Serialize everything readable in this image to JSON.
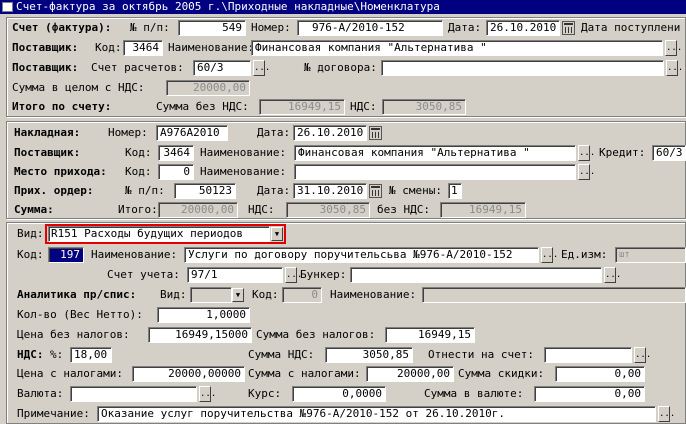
{
  "window": {
    "title": "Счет-фактура за октябрь 2005 г.\\Приходные накладные\\Номенклатура"
  },
  "invoice": {
    "title": "Счет (фактура):",
    "num_label": "№ п/п:",
    "num_value": "549",
    "number_label": "Номер:",
    "number_value": "976-А/2010-152",
    "date_label": "Дата:",
    "date_value": "26.10.2010",
    "date_received_label": "Дата поступлени",
    "supplier_label": "Поставщик:",
    "code_label": "Код:",
    "code_value": "3464",
    "name_label": "Наименование:",
    "name_value": "Финансовая компания \"Альтернатива \"",
    "supplier2_label": "Поставщик:",
    "account_label": "Счет расчетов:",
    "account_value": "60/3",
    "contract_label": "№ договора:",
    "contract_value": "",
    "sum_vat_label": "Сумма в целом с НДС:",
    "sum_vat_value": "20000,00",
    "total_label": "Итого   по   счету:",
    "sum_novat_label": "Сумма без НДС:",
    "sum_novat_value": "16949,15",
    "vat_label": "НДС:",
    "vat_value": "3050,85"
  },
  "waybill": {
    "title": "Накладная:",
    "number_label": "Номер:",
    "number_value": "А976А2010",
    "date_label": "Дата:",
    "date_value": "26.10.2010",
    "supplier_label": "Поставщик:",
    "code_label": "Код:",
    "code_value": "3464",
    "name_label": "Наименование:",
    "name_value": "Финансовая компания \"Альтернатива \"",
    "credit_label": "Кредит:",
    "credit_value": "60/3",
    "place_label": "Место прихода:",
    "place_code_label": "Код:",
    "place_code_value": "0",
    "place_name_label": "Наименование:",
    "place_name_value": "",
    "order_label": "Прих. ордер:",
    "order_num_label": "№ п/п:",
    "order_num_value": "50123",
    "order_date_label": "Дата:",
    "order_date_value": "31.10.2010",
    "shift_label": "№ смены:",
    "shift_value": "1",
    "sum_label": "Сумма:",
    "total_label": "Итого:",
    "total_value": "20000,00",
    "vat_label": "НДС:",
    "vat_value": "3050,85",
    "novat_label": "без НДС:",
    "novat_value": "16949,15"
  },
  "nomenclature": {
    "kind_label": "Вид:",
    "kind_value": "R151 Расходы будущих периодов",
    "code_label": "Код:",
    "code_value": "197",
    "name_label": "Наименование:",
    "name_value": "Услуги по договору поручительсьва №976-А/2010-152",
    "unit_label": "Ед.изм:",
    "unit_value": "шт",
    "account_label": "Счет учета:",
    "account_value": "97/1",
    "bunker_label": "Бункер:",
    "bunker_value": "",
    "analytics_label": "Аналитика пр/спис:",
    "an_kind_label": "Вид:",
    "an_kind_value": "",
    "an_code_label": "Код:",
    "an_code_value": "0",
    "an_name_label": "Наименование:",
    "an_name_value": "",
    "qty_label": "Кол-во (Вес Нетто):",
    "qty_value": "1,0000",
    "price_novat_label": "Цена без налогов:",
    "price_novat_value": "16949,15000",
    "sum_novat_label": "Сумма без налогов:",
    "sum_novat_value": "16949,15",
    "vat_label": "НДС:",
    "vat_pct_label": "%:",
    "vat_pct_value": "18,00",
    "sum_vat_label": "Сумма НДС:",
    "sum_vat_value": "3050,85",
    "attr_label": "Отнести на счет:",
    "attr_value": "",
    "price_tax_label": "Цена с налогами:",
    "price_tax_value": "20000,00000",
    "sum_tax_label": "Сумма с налогами:",
    "sum_tax_value": "20000,00",
    "discount_label": "Сумма скидки:",
    "discount_value": "0,00",
    "currency_label": "Валюта:",
    "currency_value": "",
    "rate_label": "Курс:",
    "rate_value": "0,0000",
    "sum_cur_label": "Сумма в валюте:",
    "sum_cur_value": "0,00",
    "note_label": "Примечание:",
    "note_value": "Оказание услуг поручительства №976-А/2010-152 от 26.10.2010г."
  },
  "colors": {
    "titlebar": "#000080",
    "highlight": "#000080",
    "red_border": "#e00000"
  }
}
